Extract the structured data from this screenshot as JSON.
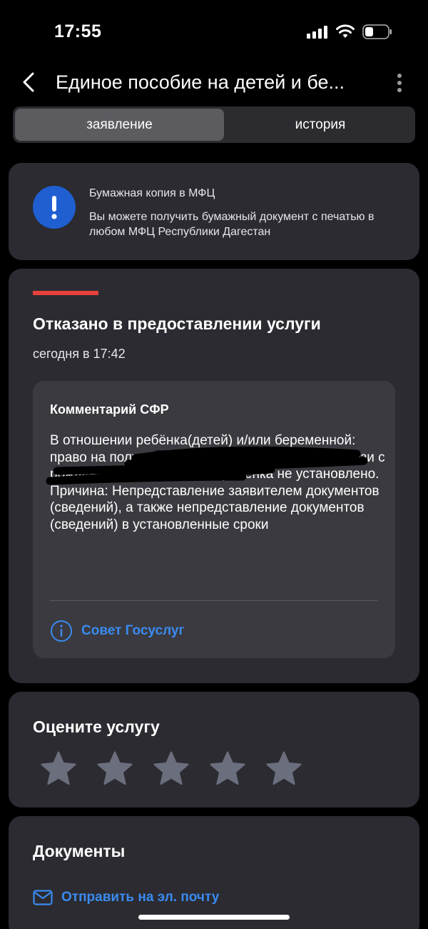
{
  "status_bar": {
    "time": "17:55",
    "icons": [
      "signal-icon",
      "wifi-icon",
      "battery-icon"
    ]
  },
  "header": {
    "title": "Единое пособие на детей и бе...",
    "back_icon": "chevron-left-icon",
    "menu_icon": "more-vertical-icon"
  },
  "tabs": [
    {
      "label": "заявление",
      "active": true
    },
    {
      "label": "история",
      "active": false
    }
  ],
  "info_card": {
    "icon": "exclamation-icon",
    "title": "Бумажная копия в МФЦ",
    "text": "Вы можете получить бумажный документ с печатью в любом МФЦ Республики Дагестан"
  },
  "status_card": {
    "title": "Отказано в предоставлении услуги",
    "time": "сегодня в 17:42",
    "comment": {
      "title": "Комментарий СФР",
      "text": "В отношении ребёнка(детей) и/или беременной: право на получение ежемесячного пособия в связи с рождением и воспитанием ребёнка не установлено. Причина: Непредставление заявителем документов (сведений), а также непредставление документов (сведений) в установленные сроки",
      "advice_label": "Совет Госуслуг"
    }
  },
  "rating": {
    "title": "Оцените услугу",
    "max_stars": 5,
    "value": 0
  },
  "documents": {
    "title": "Документы",
    "email_label": "Отправить на эл. почту"
  },
  "colors": {
    "background": "#000000",
    "card": "#2b2b31",
    "accent_blue": "#3a8bf0",
    "info_icon_blue": "#1f5fd1",
    "status_red": "#e8413b"
  }
}
